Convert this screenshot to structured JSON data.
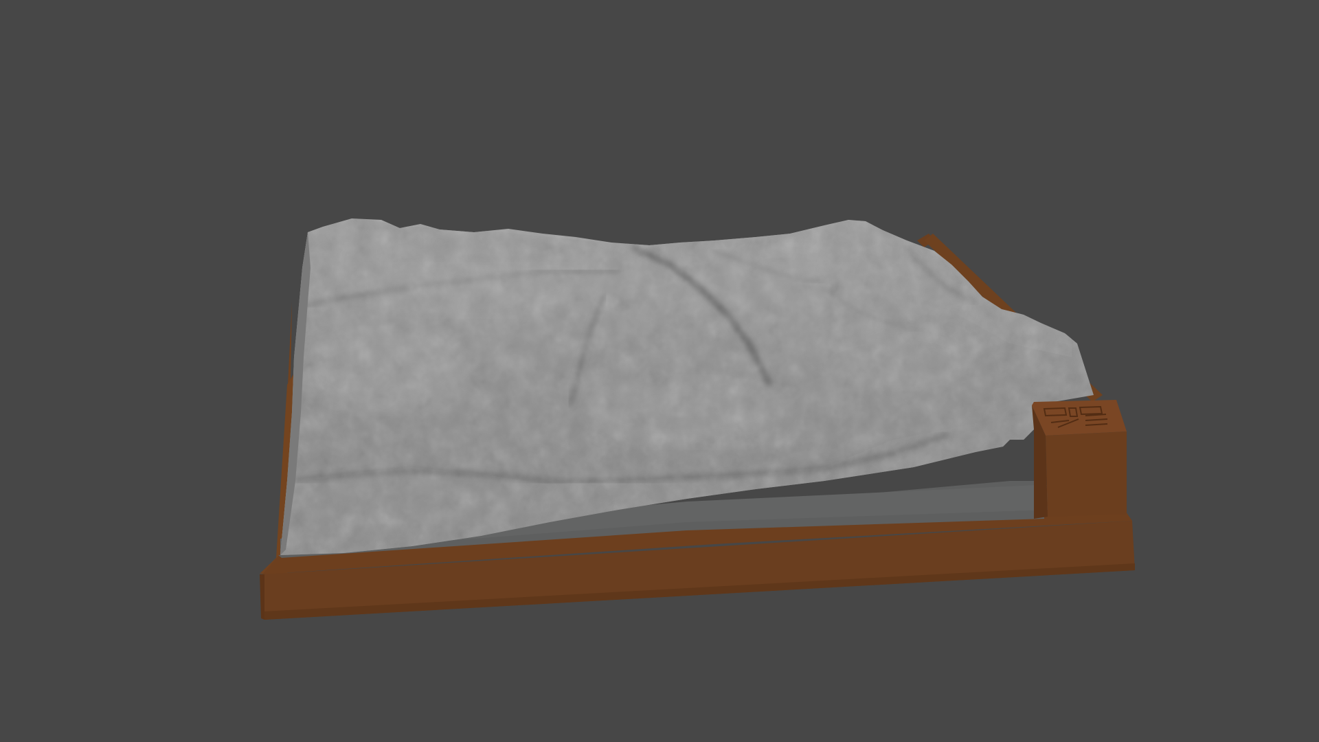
{
  "scene": {
    "subject": "terrain-relief-model",
    "colors": {
      "background": "#474747",
      "terrain": "#8e8e8e",
      "terrain_light": "#a8a8a8",
      "terrain_shadow": "#6e6e6e",
      "base_top": "#646565",
      "base_front": "#5a5b5b",
      "frame": "#6b3f1f",
      "frame_top": "#754521",
      "frame_side": "#5e3519"
    }
  }
}
